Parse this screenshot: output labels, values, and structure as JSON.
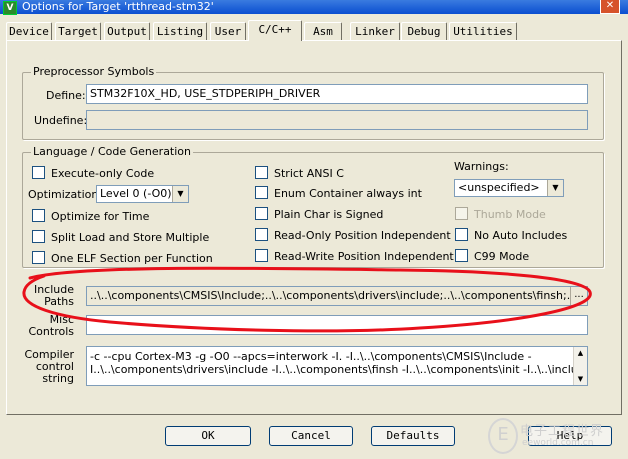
{
  "window": {
    "title": "Options for Target 'rtthread-stm32'",
    "close_glyph": "✕",
    "app_icon_glyph": "V"
  },
  "tabs": [
    {
      "label": "Device",
      "active": false
    },
    {
      "label": "Target",
      "active": false
    },
    {
      "label": "Output",
      "active": false
    },
    {
      "label": "Listing",
      "active": false
    },
    {
      "label": "User",
      "active": false
    },
    {
      "label": "C/C++",
      "active": true
    },
    {
      "label": "Asm",
      "active": false
    },
    {
      "label": "Linker",
      "active": false
    },
    {
      "label": "Debug",
      "active": false
    },
    {
      "label": "Utilities",
      "active": false
    }
  ],
  "preprocessor": {
    "legend": "Preprocessor Symbols",
    "define_label": "Define:",
    "define_value": "STM32F10X_HD, USE_STDPERIPH_DRIVER",
    "undefine_label": "Undefine:",
    "undefine_value": ""
  },
  "codegen": {
    "legend": "Language / Code Generation",
    "execute_only": "Execute-only Code",
    "optimization_label": "Optimization:",
    "optimization_value": "Level 0 (-O0)",
    "optimize_time": "Optimize for Time",
    "split_load": "Split Load and Store Multiple",
    "one_elf": "One ELF Section per Function",
    "strict_ansi": "Strict ANSI C",
    "enum_container": "Enum Container always int",
    "plain_char": "Plain Char is Signed",
    "ro_pos_indep": "Read-Only Position Independent",
    "rw_pos_indep": "Read-Write Position Independent",
    "warnings_label": "Warnings:",
    "warnings_value": "<unspecified>",
    "thumb_mode": "Thumb Mode",
    "no_auto_includes": "No Auto Includes",
    "c99_mode": "C99 Mode"
  },
  "include": {
    "label_line1": "Include",
    "label_line2": "Paths",
    "value": "..\\..\\components\\CMSIS\\Include;..\\..\\components\\drivers\\include;..\\..\\components\\finsh;..\\..\\com",
    "browse_glyph": "..."
  },
  "misc": {
    "label_line1": "Misc",
    "label_line2": "Controls",
    "value": ""
  },
  "compiler": {
    "label_line1": "Compiler",
    "label_line2": "control",
    "label_line3": "string",
    "line1": "-c --cpu Cortex-M3 -g -O0 --apcs=interwork -I. -I..\\..\\components\\CMSIS\\Include -",
    "line2": "I..\\..\\components\\drivers\\include -I..\\..\\components\\finsh -I..\\..\\components\\init -I..\\..\\include -"
  },
  "buttons": {
    "ok": "OK",
    "cancel": "Cancel",
    "defaults": "Defaults",
    "help": "Help"
  },
  "watermark": {
    "cn_text": "电子工程世界",
    "en_text": "eeworld.com.cn",
    "logo_glyph": "E"
  },
  "colors": {
    "annotation_red": "#e8101a",
    "titlebar_blue": "#0a4ed0"
  }
}
